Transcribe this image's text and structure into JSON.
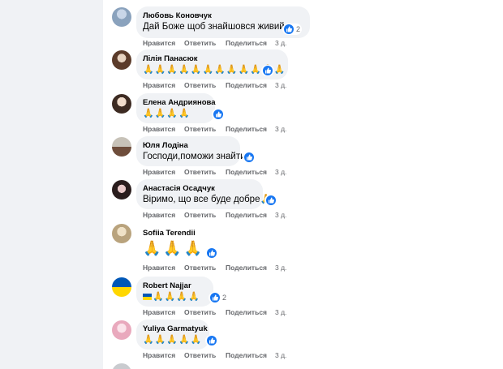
{
  "actions": {
    "like": "Нравится",
    "reply": "Ответить",
    "share": "Поделиться"
  },
  "comments": [
    {
      "author": "Любовь Коновчук",
      "text": "Дай Боже щоб знайшовся живий.",
      "reactions": "2",
      "time": "3 д."
    },
    {
      "author": "Лілія Панасюк",
      "text": "🙏🙏🙏🙏🙏🙏🙏🙏🙏🙏🙏🙏",
      "reactions": "",
      "time": "3 д."
    },
    {
      "author": "Елена Андриянова",
      "text": "🙏🙏🙏🙏",
      "reactions": "",
      "time": "3 д."
    },
    {
      "author": "Юля Лодіна",
      "text": "Господи,поможи знайти",
      "reactions": "",
      "time": "3 д."
    },
    {
      "author": "Анастасія Осадчук",
      "text": "Віримо, що все буде добре🙏",
      "reactions": "",
      "time": "3 д."
    },
    {
      "author": "Sofiia Terendii",
      "text": "🙏🙏🙏",
      "reactions": "",
      "time": "3 д."
    },
    {
      "author": "Robert Najjar",
      "text": "🙏🙏🙏🙏",
      "reactions": "2",
      "time": "3 д."
    },
    {
      "author": "Yuliya Garmatyuk",
      "text": "🙏🙏🙏🙏🙏",
      "reactions": "",
      "time": "3 д."
    }
  ],
  "colors": {
    "accent": "#1877f2",
    "bubble": "#f0f2f5",
    "muted": "#65676b"
  }
}
